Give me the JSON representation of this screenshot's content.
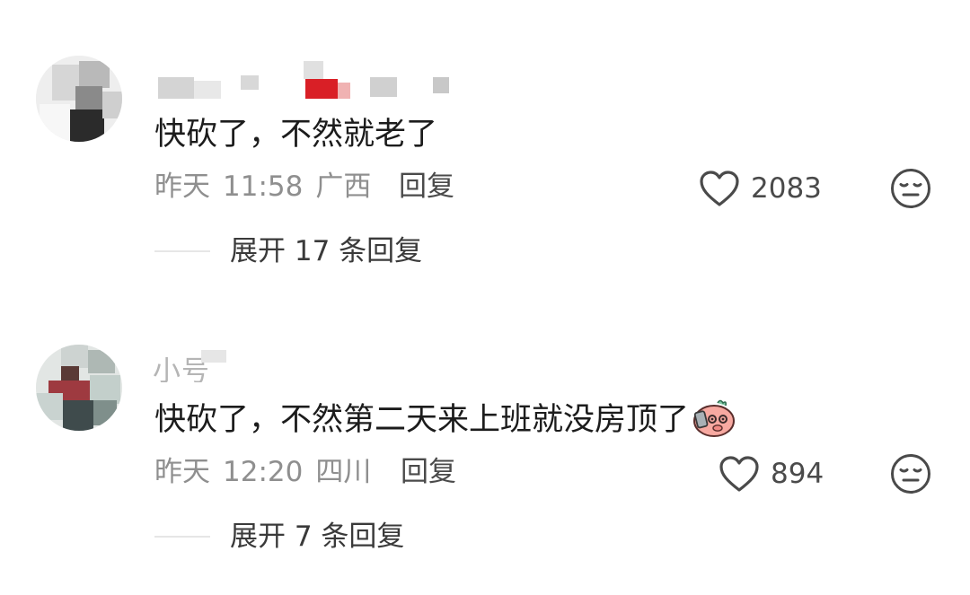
{
  "comments": [
    {
      "username": "",
      "text": "快砍了，不然就老了",
      "date": "昨天",
      "time": "11:58",
      "location": "广西",
      "reply_label": "回复",
      "likes": "2083",
      "expand_label": "展开 17 条回复"
    },
    {
      "username": "小号",
      "text": "快砍了，不然第二天来上班就没房顶了",
      "date": "昨天",
      "time": "12:20",
      "location": "四川",
      "reply_label": "回复",
      "likes": "894",
      "expand_label": "展开 7 条回复"
    }
  ],
  "icons": {
    "like": "heart-outline-icon",
    "dislike": "meh-face-icon",
    "inline_sticker": "pink-pig-sticker"
  },
  "colors": {
    "text": "#1c1c1c",
    "meta": "#8f8f8f",
    "icon": "#4a4a4a",
    "divider": "#e6e6e6",
    "sticker_pink": "#f7a9a1"
  }
}
